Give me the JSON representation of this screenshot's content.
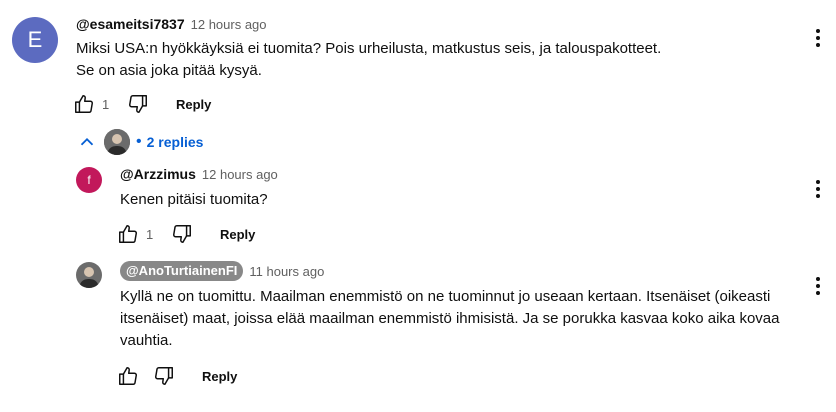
{
  "comment": {
    "avatar_letter": "E",
    "avatar_color": "#5c6bc0",
    "handle": "@esameitsi7837",
    "time": "12 hours ago",
    "text_line1": "Miksi USA:n hyökkäyksiä ei tuomita? Pois urheilusta, matkustus seis, ja talouspakotteet.",
    "text_line2": "Se on asia joka pitää kysyä.",
    "likes": "1",
    "reply_label": "Reply",
    "replies_label": "2 replies",
    "replies_color": "#065fd4"
  },
  "replies": [
    {
      "avatar_letter": "f",
      "avatar_color": "#c2185b",
      "handle": "@Arzzimus",
      "time": "12 hours ago",
      "text": "Kenen pitäisi tuomita?",
      "likes": "1",
      "reply_label": "Reply"
    },
    {
      "handle": "@AnoTurtiainenFI",
      "time": "11 hours ago",
      "text": "Kyllä ne on tuomittu. Maailman enemmistö on ne tuominnut jo useaan kertaan. Itsenäiset (oikeasti itsenäiset) maat, joissa elää maailman enemmistö ihmisistä. Ja se porukka kasvaa koko aika kovaa vauhtia.",
      "likes": "",
      "reply_label": "Reply"
    }
  ]
}
